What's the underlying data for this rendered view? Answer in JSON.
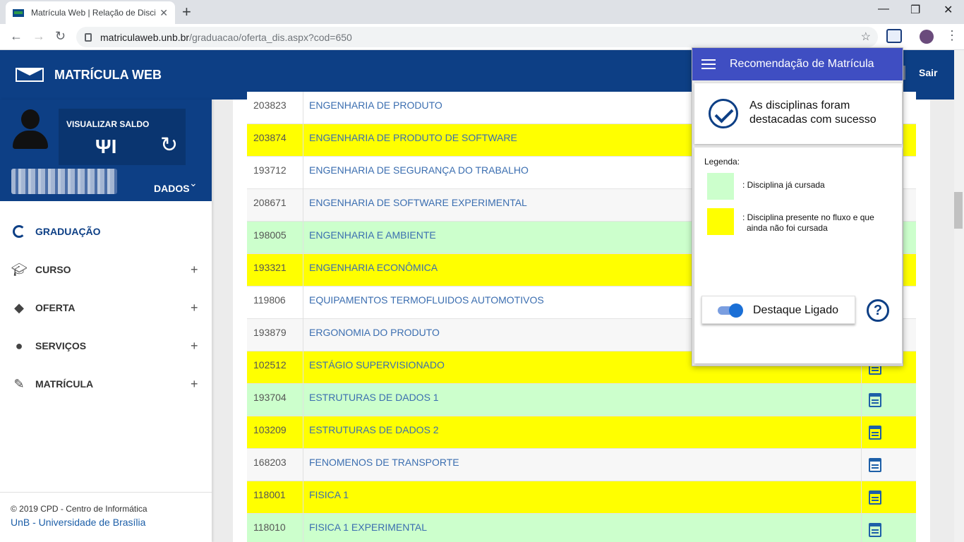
{
  "browser": {
    "tab_title": "Matrícula Web | Relação de Disci",
    "tab_close": "✕",
    "new_tab": "+",
    "url_host": "matriculaweb.unb.br",
    "url_path": "/graduacao/oferta_dis.aspx?cod=650",
    "minimize": "—",
    "maximize": "❐",
    "close": "✕"
  },
  "header": {
    "title": "MATRÍCULA WEB",
    "logout": "Sair"
  },
  "profile": {
    "balance_label": "VISUALIZAR SALDO",
    "data_label": "DADOS"
  },
  "sidebar": {
    "items": [
      {
        "label": "GRADUAÇÃO",
        "icon": "circle-notch-icon"
      },
      {
        "label": "CURSO",
        "icon": "graduation-cap-icon"
      },
      {
        "label": "OFERTA",
        "icon": "tag-icon"
      },
      {
        "label": "SERVIÇOS",
        "icon": "bubbles-icon"
      },
      {
        "label": "MATRÍCULA",
        "icon": "pencil-icon"
      }
    ],
    "expand_symbol": "+"
  },
  "footer": {
    "copyright": "© 2019 CPD - Centro de Informática",
    "university": "UnB - Universidade de Brasília"
  },
  "courses": [
    {
      "code": "203823",
      "name": "ENGENHARIA DE PRODUTO",
      "status": "white"
    },
    {
      "code": "203874",
      "name": "ENGENHARIA DE PRODUTO DE SOFTWARE",
      "status": "yellow"
    },
    {
      "code": "193712",
      "name": "ENGENHARIA DE SEGURANÇA DO TRABALHO",
      "status": "white"
    },
    {
      "code": "208671",
      "name": "ENGENHARIA DE SOFTWARE EXPERIMENTAL",
      "status": "grey"
    },
    {
      "code": "198005",
      "name": "ENGENHARIA E AMBIENTE",
      "status": "green"
    },
    {
      "code": "193321",
      "name": "ENGENHARIA ECONÔMICA",
      "status": "yellow"
    },
    {
      "code": "119806",
      "name": "EQUIPAMENTOS TERMOFLUIDOS AUTOMOTIVOS",
      "status": "white"
    },
    {
      "code": "193879",
      "name": "ERGONOMIA DO PRODUTO",
      "status": "grey"
    },
    {
      "code": "102512",
      "name": "ESTÁGIO SUPERVISIONADO",
      "status": "yellow"
    },
    {
      "code": "193704",
      "name": "ESTRUTURAS DE DADOS 1",
      "status": "green"
    },
    {
      "code": "103209",
      "name": "ESTRUTURAS DE DADOS 2",
      "status": "yellow"
    },
    {
      "code": "168203",
      "name": "FENOMENOS DE TRANSPORTE",
      "status": "grey"
    },
    {
      "code": "118001",
      "name": "FISICA 1",
      "status": "yellow"
    },
    {
      "code": "118010",
      "name": "FISICA 1 EXPERIMENTAL",
      "status": "green"
    }
  ],
  "popup": {
    "title": "Recomendação de Matrícula",
    "success_line1": "As disciplinas foram",
    "success_line2": "destacadas com sucesso",
    "legend_title": "Legenda:",
    "legend_taken": ": Disciplina já cursada",
    "legend_pending_1": ": Disciplina presente no fluxo e que",
    "legend_pending_2": "ainda não foi cursada",
    "toggle_label": "Destaque Ligado",
    "toggle_on": true,
    "help": "?",
    "colors": {
      "taken": "#ccffcc",
      "pending": "#ffff00",
      "accent": "#3f4ec2"
    }
  }
}
